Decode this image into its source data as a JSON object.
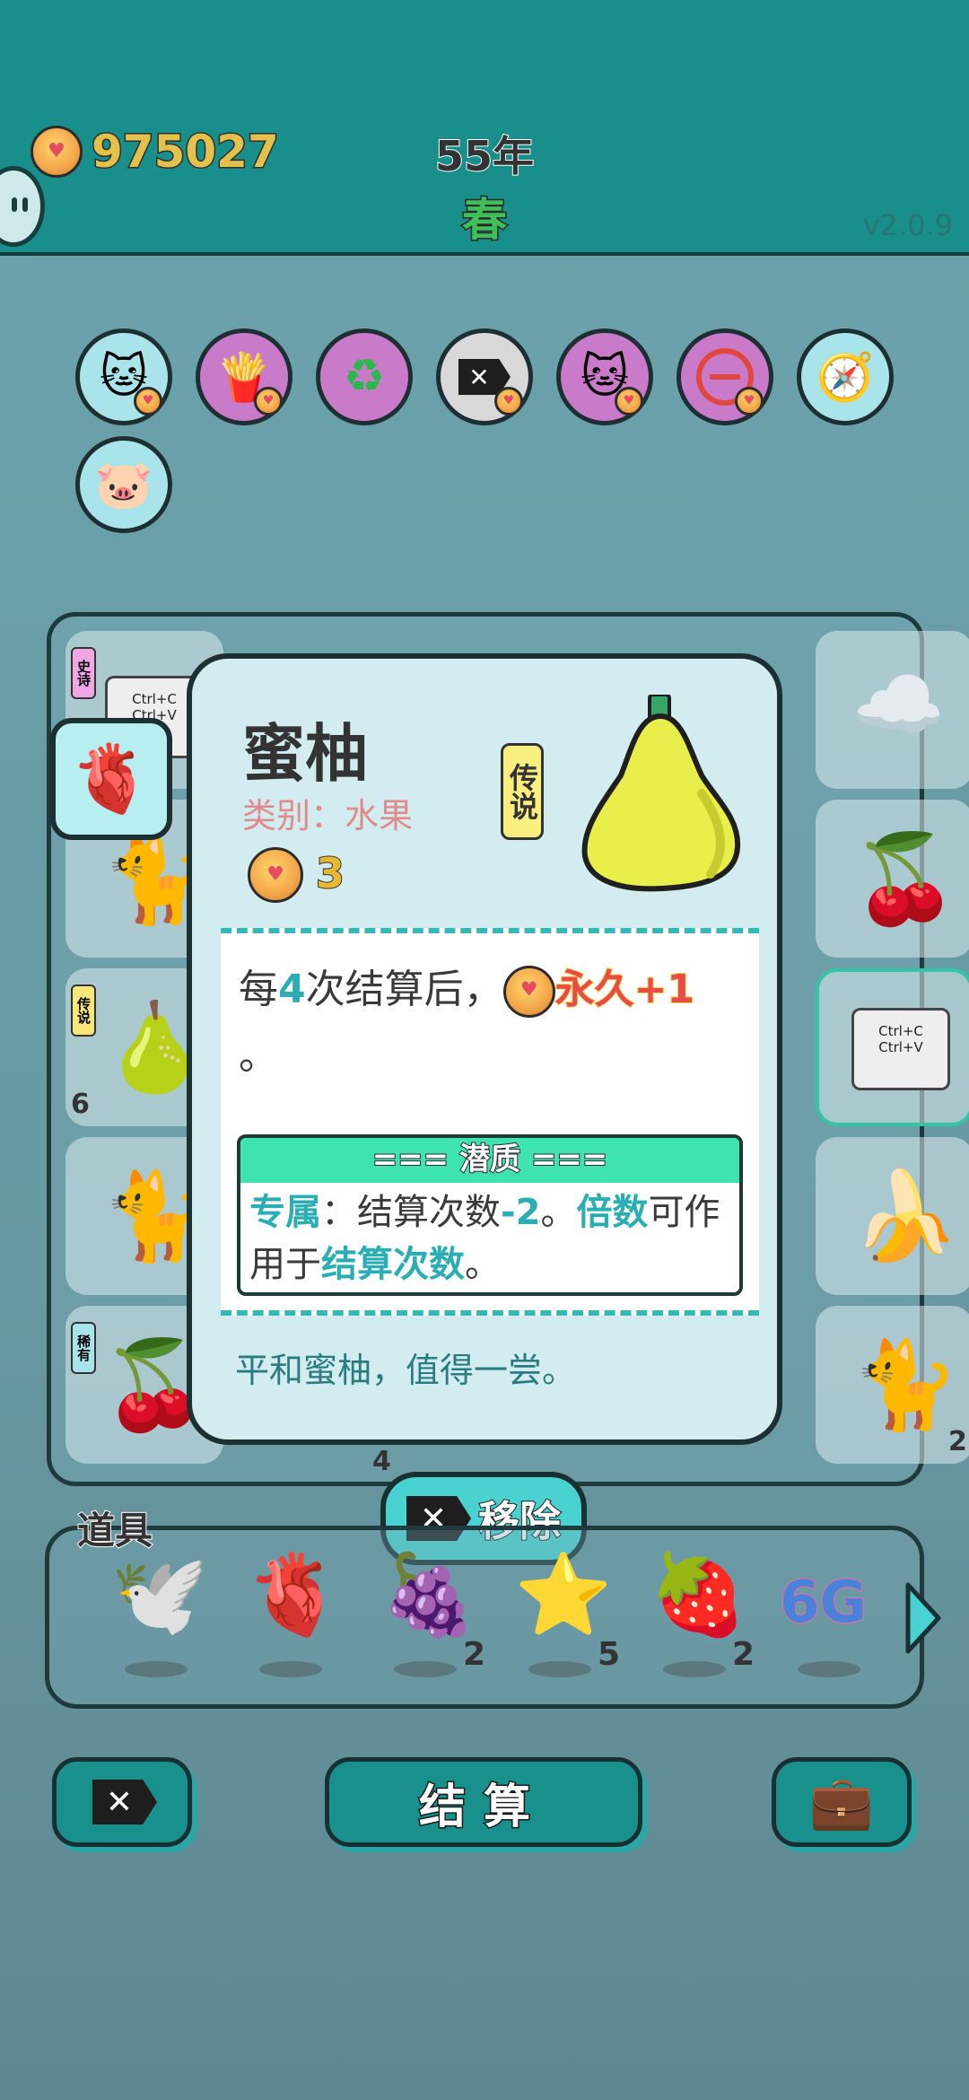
{
  "header": {
    "coins": "975027",
    "year": "55年",
    "season": "春",
    "version": "v2.0.9"
  },
  "toolbar": {
    "icons": [
      "cat-portrait-icon",
      "fries-icon",
      "recycle-icon",
      "remove-tag-icon",
      "cats-icon",
      "minus-icon",
      "compass-icon",
      "piggy-bank-icon"
    ]
  },
  "board": {
    "badge_rare": "稀有",
    "badge_legend": "传说",
    "badge_epic": "史诗",
    "copy_label": "Ctrl+C\nCtrl+V",
    "counts": {
      "pomelo": "6",
      "bottom_mid": "4",
      "bottom_right": "2"
    }
  },
  "popup": {
    "title": "蜜柚",
    "category": "类别：水果",
    "rarity": "传说",
    "price": "3",
    "desc_prefix": "每",
    "desc_num": "4",
    "desc_mid": "次结算后，",
    "desc_perm": "永久+1",
    "desc_end": "。",
    "trait_title": "=== 潜质 ===",
    "trait_exclusive": "专属",
    "trait_colon": "：结算次数",
    "trait_minus": "-2",
    "trait_dot": "。",
    "trait_mult": "倍数",
    "trait_can": "可作用于",
    "trait_target": "结算次数",
    "trait_end": "。",
    "flavor": "平和蜜柚，值得一尝。"
  },
  "remove_button": {
    "label": "移除"
  },
  "items": {
    "label": "道具",
    "list": [
      {
        "name": "bird",
        "count": ""
      },
      {
        "name": "liver",
        "count": ""
      },
      {
        "name": "bayberry",
        "count": "2"
      },
      {
        "name": "star",
        "count": "5"
      },
      {
        "name": "strawberry",
        "count": "2"
      },
      {
        "name": "6g",
        "count": ""
      }
    ],
    "text_6g": "6G"
  },
  "bottom": {
    "settle_label": "结算"
  }
}
